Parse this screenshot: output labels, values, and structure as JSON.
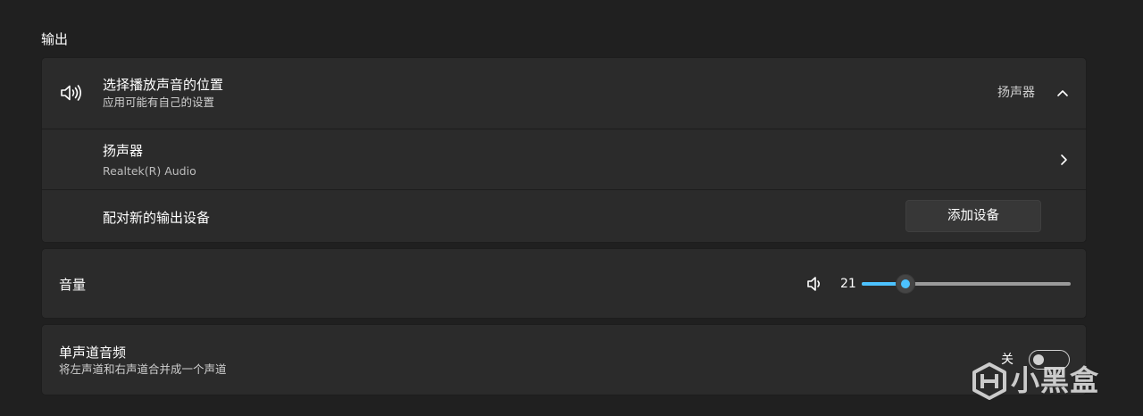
{
  "section": {
    "title": "输出"
  },
  "output": {
    "title": "选择播放声音的位置",
    "subtitle": "应用可能有自己的设置",
    "selected_value": "扬声器",
    "icon": "speaker-icon",
    "expand_icon": "chevron-up-icon",
    "devices": [
      {
        "name": "扬声器",
        "detail": "Realtek(R) Audio",
        "icon": "chevron-right-icon"
      }
    ],
    "pair": {
      "label": "配对新的输出设备",
      "button_label": "添加设备"
    }
  },
  "volume": {
    "label": "音量",
    "value": "21",
    "level": 21,
    "icon": "speaker-low-icon",
    "accent_color": "#4cc2ff"
  },
  "mono": {
    "title": "单声道音频",
    "subtitle": "将左声道和右声道合并成一个声道",
    "state_label": "关",
    "enabled": false
  },
  "watermark": {
    "text": "小黑盒",
    "icon": "xiaoheihe-logo"
  }
}
